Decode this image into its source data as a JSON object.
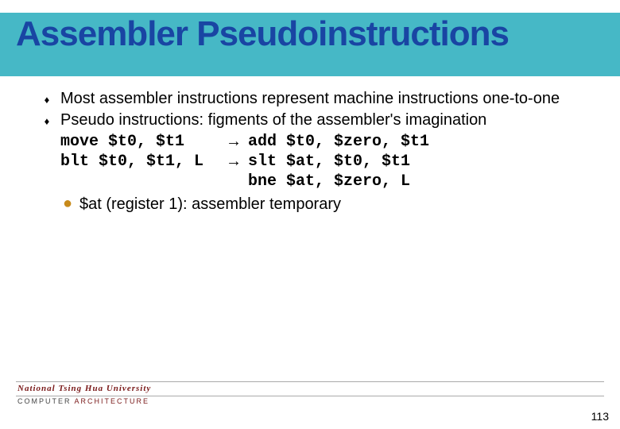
{
  "title": "Assembler Pseudoinstructions",
  "bullets": [
    "Most assembler instructions represent machine instructions one-to-one",
    "Pseudo instructions: figments of the assembler's imagination"
  ],
  "code": {
    "r0_left": "move $t0, $t1",
    "r0_arrow": "→",
    "r0_right": "add $t0, $zero, $t1",
    "r1_left": "blt $t0, $t1, L",
    "r1_arrow": "→",
    "r1_right": "slt $at, $t0, $t1",
    "r2_right": "bne $at, $zero, L"
  },
  "sub_bullet": "$at (register 1): assembler temporary",
  "footer": {
    "university": "National Tsing Hua University",
    "dept_prefix": "COMPUTER ",
    "dept_arch": "ARCHITECTURE"
  },
  "page_number": "113"
}
